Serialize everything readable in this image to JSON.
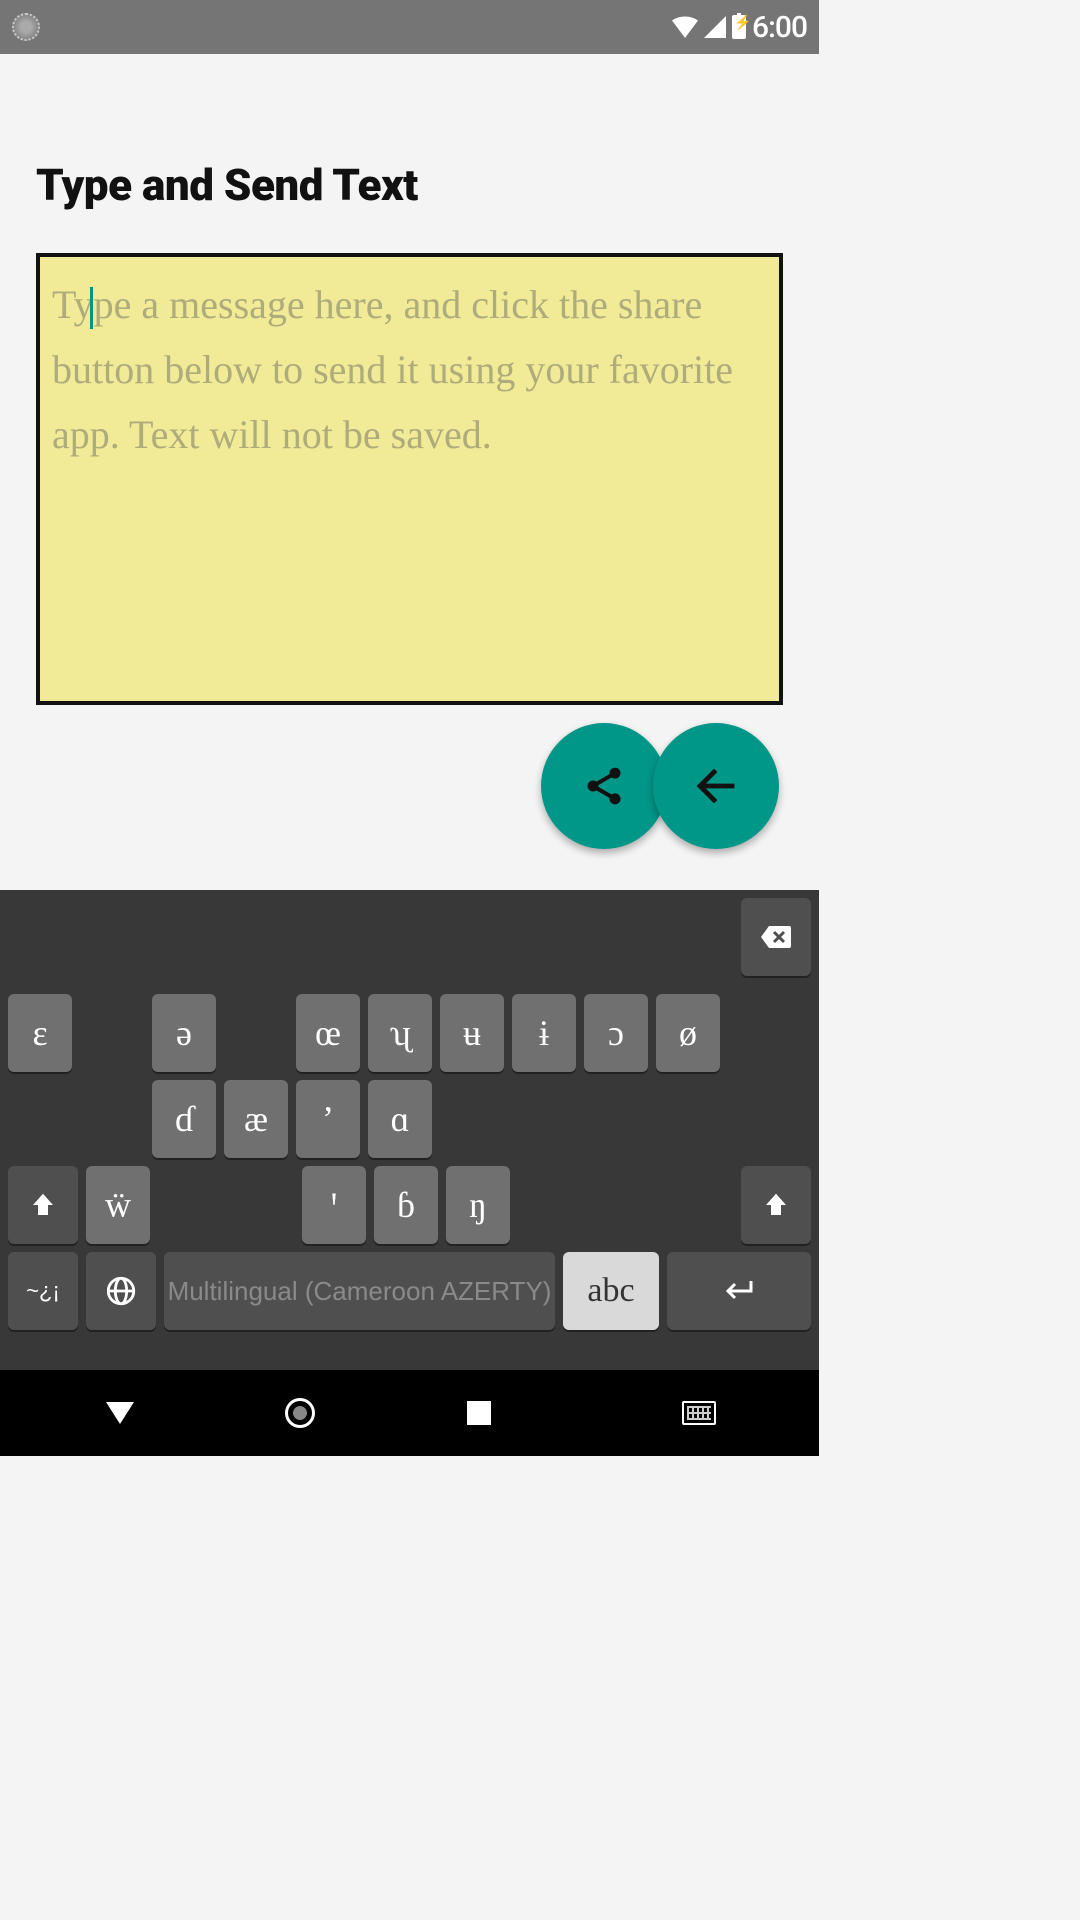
{
  "status_bar": {
    "clock": "6:00"
  },
  "main": {
    "title": "Type and Send Text",
    "placeholder": "Type a message here, and click the share button below to send it using your favorite app. Text will not be saved."
  },
  "fab": {
    "share": "share",
    "back": "back"
  },
  "keyboard": {
    "backspace": "⌫",
    "row1": [
      "ɛ",
      "",
      "ə",
      "",
      "œ",
      "ʯ",
      "ʉ",
      "ɨ",
      "ɔ",
      "ø"
    ],
    "row2": [
      "",
      "ɗ",
      "æ",
      "ʼ",
      "ɑ",
      "",
      "",
      "",
      "",
      ""
    ],
    "row3_shift_l": "⇧",
    "row3": [
      "ẅ",
      "",
      "",
      "ꞌ",
      "ɓ",
      "ŋ",
      "",
      "",
      ""
    ],
    "row3_shift_r": "⇧",
    "row4_sym": "~¿¡",
    "row4_lang_label": "Multilingual (Cameroon AZERTY)",
    "row4_abc": "abc",
    "row4_enter": "↵"
  },
  "nav": {
    "back": "back",
    "home": "home",
    "recent": "recent",
    "keyboard": "keyboard"
  }
}
